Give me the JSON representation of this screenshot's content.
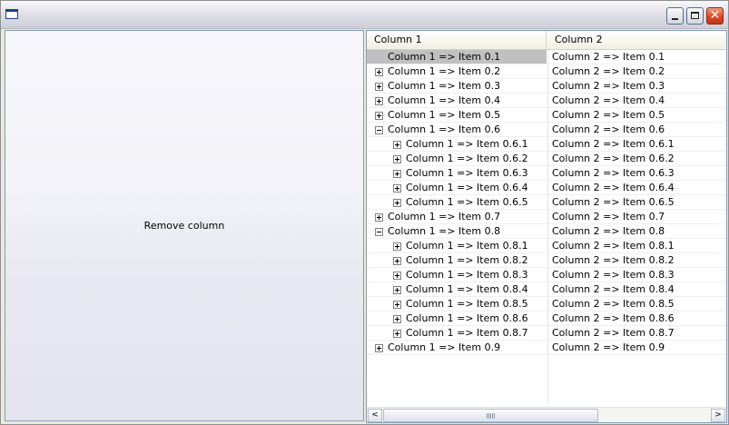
{
  "window": {
    "title": ""
  },
  "left_pane": {
    "button_label": "Remove column"
  },
  "tree": {
    "columns": [
      "Column 1",
      "Column 2"
    ],
    "rows": [
      {
        "c1": "Column 1 => Item 0.1",
        "c2": "Column 2 => Item 0.1",
        "level": 0,
        "expander": "none",
        "selected": true
      },
      {
        "c1": "Column 1 => Item 0.2",
        "c2": "Column 2 => Item 0.2",
        "level": 0,
        "expander": "plus"
      },
      {
        "c1": "Column 1 => Item 0.3",
        "c2": "Column 2 => Item 0.3",
        "level": 0,
        "expander": "plus"
      },
      {
        "c1": "Column 1 => Item 0.4",
        "c2": "Column 2 => Item 0.4",
        "level": 0,
        "expander": "plus"
      },
      {
        "c1": "Column 1 => Item 0.5",
        "c2": "Column 2 => Item 0.5",
        "level": 0,
        "expander": "plus"
      },
      {
        "c1": "Column 1 => Item 0.6",
        "c2": "Column 2 => Item 0.6",
        "level": 0,
        "expander": "minus"
      },
      {
        "c1": "Column 1 => Item 0.6.1",
        "c2": "Column 2 => Item 0.6.1",
        "level": 1,
        "expander": "plus"
      },
      {
        "c1": "Column 1 => Item 0.6.2",
        "c2": "Column 2 => Item 0.6.2",
        "level": 1,
        "expander": "plus"
      },
      {
        "c1": "Column 1 => Item 0.6.3",
        "c2": "Column 2 => Item 0.6.3",
        "level": 1,
        "expander": "plus"
      },
      {
        "c1": "Column 1 => Item 0.6.4",
        "c2": "Column 2 => Item 0.6.4",
        "level": 1,
        "expander": "plus"
      },
      {
        "c1": "Column 1 => Item 0.6.5",
        "c2": "Column 2 => Item 0.6.5",
        "level": 1,
        "expander": "plus"
      },
      {
        "c1": "Column 1 => Item 0.7",
        "c2": "Column 2 => Item 0.7",
        "level": 0,
        "expander": "plus"
      },
      {
        "c1": "Column 1 => Item 0.8",
        "c2": "Column 2 => Item 0.8",
        "level": 0,
        "expander": "minus"
      },
      {
        "c1": "Column 1 => Item 0.8.1",
        "c2": "Column 2 => Item 0.8.1",
        "level": 1,
        "expander": "plus"
      },
      {
        "c1": "Column 1 => Item 0.8.2",
        "c2": "Column 2 => Item 0.8.2",
        "level": 1,
        "expander": "plus"
      },
      {
        "c1": "Column 1 => Item 0.8.3",
        "c2": "Column 2 => Item 0.8.3",
        "level": 1,
        "expander": "plus"
      },
      {
        "c1": "Column 1 => Item 0.8.4",
        "c2": "Column 2 => Item 0.8.4",
        "level": 1,
        "expander": "plus"
      },
      {
        "c1": "Column 1 => Item 0.8.5",
        "c2": "Column 2 => Item 0.8.5",
        "level": 1,
        "expander": "plus"
      },
      {
        "c1": "Column 1 => Item 0.8.6",
        "c2": "Column 2 => Item 0.8.6",
        "level": 1,
        "expander": "plus"
      },
      {
        "c1": "Column 1 => Item 0.8.7",
        "c2": "Column 2 => Item 0.8.7",
        "level": 1,
        "expander": "plus"
      },
      {
        "c1": "Column 1 => Item 0.9",
        "c2": "Column 2 => Item 0.9",
        "level": 0,
        "expander": "plus"
      }
    ]
  },
  "scrollbar": {
    "left_arrow": "<",
    "right_arrow": ">"
  },
  "title_buttons": {
    "close_glyph": "✕"
  },
  "colors": {
    "selection": "#c0c0c0",
    "border": "#7f9db9",
    "close": "#d9441f"
  }
}
